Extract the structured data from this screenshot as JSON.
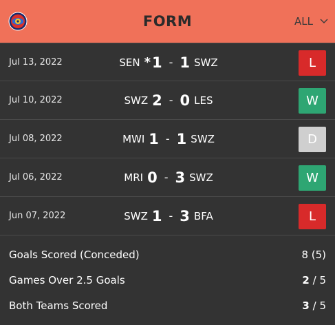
{
  "header": {
    "title": "FORM",
    "filter_label": "ALL",
    "filter_icon": "chevron-down-icon",
    "logo_icon": "team-crest-icon"
  },
  "colors": {
    "header_bg": "#f07159",
    "win": "#2ea673",
    "loss": "#d82a2a",
    "draw": "#cfcfcf"
  },
  "matches": [
    {
      "date": "Jul 13, 2022",
      "home": "SEN",
      "home_star": "*",
      "home_goals": "1",
      "sep": "-",
      "away_goals": "1",
      "away": "SWZ",
      "result": "L"
    },
    {
      "date": "Jul 10, 2022",
      "home": "SWZ",
      "home_star": "",
      "home_goals": "2",
      "sep": "-",
      "away_goals": "0",
      "away": "LES",
      "result": "W"
    },
    {
      "date": "Jul 08, 2022",
      "home": "MWI",
      "home_star": "",
      "home_goals": "1",
      "sep": "-",
      "away_goals": "1",
      "away": "SWZ",
      "result": "D"
    },
    {
      "date": "Jul 06, 2022",
      "home": "MRI",
      "home_star": "",
      "home_goals": "0",
      "sep": "-",
      "away_goals": "3",
      "away": "SWZ",
      "result": "W"
    },
    {
      "date": "Jun 07, 2022",
      "home": "SWZ",
      "home_star": "",
      "home_goals": "1",
      "sep": "-",
      "away_goals": "3",
      "away": "BFA",
      "result": "L"
    }
  ],
  "stats": [
    {
      "label": "Goals Scored (Conceded)",
      "value_main": "8 (5)",
      "value_rest": ""
    },
    {
      "label": "Games Over 2.5 Goals",
      "value_main": "2",
      "value_rest": " / 5"
    },
    {
      "label": "Both Teams Scored",
      "value_main": "3",
      "value_rest": " / 5"
    }
  ]
}
